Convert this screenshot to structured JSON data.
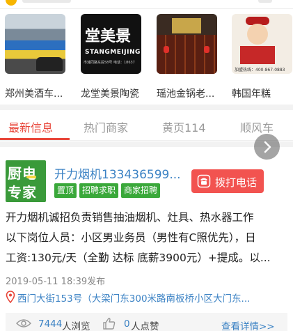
{
  "shops": [
    {
      "name": "郑州美酒车...",
      "image": "storefront-yellow-shop"
    },
    {
      "name": "龙堂美景陶瓷",
      "image": "storefront-black-sign",
      "sign_text": "堂美景",
      "sign_en": "STANGMEIJING",
      "sign_small": "市浦同路东段58号  电话：18637"
    },
    {
      "name": "瑶池金锅老...",
      "image": "storefront-red-restaurant"
    },
    {
      "name": "韩国年糕",
      "image": "storefront-chef-logo",
      "phone_text": "加盟热线：400-867-0883"
    }
  ],
  "tabs": [
    {
      "label": "最新信息",
      "active": true
    },
    {
      "label": "热门商家",
      "active": false
    },
    {
      "label": "黄页114",
      "active": false
    },
    {
      "label": "顺风车",
      "active": false
    }
  ],
  "listing": {
    "logo_line1": "厨电",
    "logo_line2": "专家",
    "title": "开力烟机133436599...",
    "tags": [
      "置顶",
      "招聘求职",
      "商家招聘"
    ],
    "call_label": "拨打电话",
    "description_lines": [
      "开力烟机诚招负责销售抽油烟机、灶具、热水器工作",
      "以下岗位人员：小区男业务员（男性有C照优先），日",
      "工资:130元/天（全勤 达标 底薪3900元）+提成。以..."
    ],
    "date": "2019-05-11 18:39发布",
    "address": "西门大街153号（大梁门东300米路南板桥小区大门东...",
    "views": "7444",
    "views_label": "人浏览",
    "likes": "0",
    "likes_label": "人点赞",
    "details_label": "查看详情>>"
  },
  "colors": {
    "accent_red": "#e8463a",
    "link_blue": "#3b82c4",
    "tag_green": "#3aa83a",
    "call_button": "#f25350"
  },
  "icons": {
    "scroll_button": "chevron-right-icon",
    "call": "phone-icon",
    "address": "location-pin-icon",
    "views": "eye-icon",
    "likes": "thumbs-up-icon"
  }
}
